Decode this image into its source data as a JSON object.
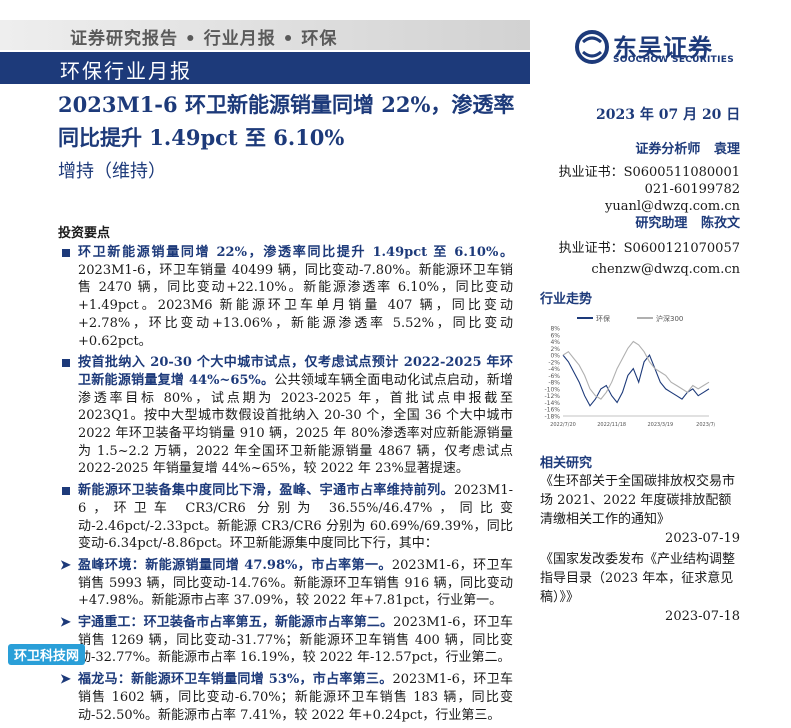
{
  "header": {
    "breadcrumb": "证券研究报告 • 行业月报 • 环保",
    "report_type": "环保行业月报",
    "logo_cn": "东吴证券",
    "logo_en": "SOOCHOW SECURITIES"
  },
  "title": "2023M1-6 环卫新能源销量同增 22%，渗透率同比提升 1.49pct 至 6.10%",
  "rating": "增持（维持）",
  "date": "2023 年 07 月 20 日",
  "analysts": [
    {
      "role": "证券分析师",
      "name": "袁理",
      "license": "执业证书：S0600511080001",
      "phone": "021-60199782",
      "email": "yuanl@dwzq.com.cn"
    },
    {
      "role": "研究助理",
      "name": "陈孜文",
      "license": "执业证书：S0600121070057",
      "email": "chenzw@dwzq.com.cn"
    }
  ],
  "invest_points_title": "投资要点",
  "points": [
    {
      "lead": "环卫新能源销量同增 22%，渗透率同比提升 1.49pct 至 6.10%。",
      "body": "2023M1-6，环卫车销量 40499 辆，同比变动-7.80%。新能源环卫车销售 2470 辆，同比变动+22.10%。新能源渗透率 6.10%，同比变动+1.49pct。2023M6 新能源环卫车单月销量 407 辆，同比变动+2.78%，环比变动+13.06%，新能源渗透率 5.52%，同比变动+0.62pct。"
    },
    {
      "lead": "按首批纳入 20-30 个大中城市试点，仅考虑试点预计 2022-2025 年环卫新能源销量复增 44%~65%。",
      "body": "公共领域车辆全面电动化试点启动，新增渗透率目标 80%，试点期为 2023-2025 年，首批试点申报截至 2023Q1。按中大型城市数假设首批纳入 20-30 个，全国 36 个大中城市 2022 年环卫装备平均销量 910 辆，2025 年 80%渗透率对应新能源销量为 1.5~2.2 万辆，2022 年全国环卫新能源销量 4867 辆，仅考虑试点 2022-2025 年销量复增 44%~65%，较 2022 年 23%显著提速。"
    },
    {
      "lead": "新能源环卫装备集中度同比下滑，盈峰、宇通市占率维持前列。",
      "body": "2023M1-6，环卫车 CR3/CR6 分别为 36.55%/46.47%，同比变动-2.46pct/-2.33pct。新能源 CR3/CR6 分别为 60.69%/69.39%，同比变动-6.34pct/-8.86pct。环卫新能源集中度同比下行，其中："
    }
  ],
  "sub_points": [
    {
      "lead": "盈峰环境：新能源销量同增 47.98%，市占率第一。",
      "body": "2023M1-6，环卫车销售 5993 辆，同比变动-14.76%。新能源环卫车销售 916 辆，同比变动+47.98%。新能源市占率 37.09%，较 2022 年+7.81pct，行业第一。"
    },
    {
      "lead": "宇通重工：环卫装备市占率第五，新能源市占率第二。",
      "body": "2023M1-6，环卫车销售 1269 辆，同比变动-31.77%；新能源环卫车销售 400 辆，同比变动-32.77%。新能源市占率 16.19%，较 2022 年-12.57pct，行业第二。"
    },
    {
      "lead": "福龙马：新能源环卫车销量同增 53%，市占率第三。",
      "body": "2023M1-6，环卫车销售 1602 辆，同比变动-6.70%；新能源环卫车销售 183 辆，同比变动-52.50%。新能源市占率 7.41%，较 2022 年+0.24pct，行业第三。"
    }
  ],
  "chart_title": "行业走势",
  "chart_data": {
    "type": "line",
    "x_ticks": [
      "2022/7/20",
      "2022/11/18",
      "2023/3/19",
      "2023/7/18"
    ],
    "ylim": [
      -18,
      8
    ],
    "y_ticks": [
      "8%",
      "6%",
      "4%",
      "2%",
      "0%",
      "-2%",
      "-4%",
      "-6%",
      "-8%",
      "-10%",
      "-12%",
      "-14%",
      "-16%",
      "-18%"
    ],
    "series": [
      {
        "name": "环保",
        "color": "#1d3a7a",
        "values": [
          0,
          -2,
          -5,
          -8,
          -12,
          -15,
          -13,
          -10,
          -9,
          -12,
          -14,
          -11,
          -6,
          -4,
          -8,
          -2,
          0,
          -4,
          -8,
          -10,
          -11,
          -12,
          -13,
          -11,
          -10,
          -12,
          -11,
          -10
        ]
      },
      {
        "name": "沪深300",
        "color": "#b0b0b0",
        "values": [
          0,
          1,
          -1,
          -3,
          -6,
          -10,
          -12,
          -13,
          -11,
          -8,
          -4,
          -1,
          2,
          4,
          3,
          1,
          -2,
          -4,
          -5,
          -6,
          -8,
          -9,
          -10,
          -11,
          -9,
          -10,
          -9,
          -8
        ]
      }
    ],
    "legend": "top"
  },
  "related_title": "相关研究",
  "related": [
    {
      "title": "《生环部关于全国碳排放权交易市场 2021、2022 年度碳排放配额清缴相关工作的通知》",
      "date": "2023-07-19"
    },
    {
      "title": "《国家发改委发布《产业结构调整指导目录（2023 年本，征求意见稿）》》",
      "date": "2023-07-18"
    }
  ],
  "watermark": "环卫科技网"
}
